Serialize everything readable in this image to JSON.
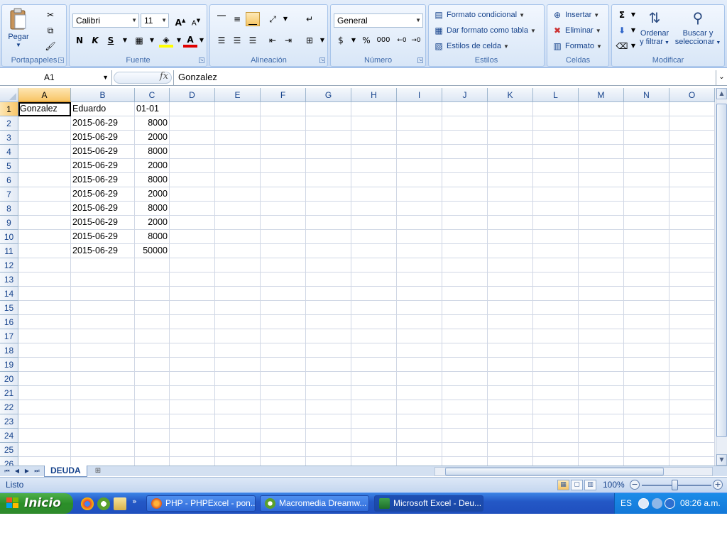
{
  "ribbon": {
    "clipboard": {
      "label": "Portapapeles",
      "paste": "Pegar"
    },
    "font": {
      "label": "Fuente",
      "name": "Calibri",
      "size": "11",
      "bold": "N",
      "italic": "K",
      "underline": "S"
    },
    "alignment": {
      "label": "Alineación"
    },
    "number": {
      "label": "Número",
      "format": "General",
      "percent": "%",
      "thousands": "000"
    },
    "styles": {
      "label": "Estilos",
      "conditional": "Formato condicional",
      "as_table": "Dar formato como tabla",
      "cell_styles": "Estilos de celda"
    },
    "cells": {
      "label": "Celdas",
      "insert": "Insertar",
      "delete": "Eliminar",
      "format": "Formato"
    },
    "editing": {
      "label": "Modificar",
      "sort_line1": "Ordenar",
      "sort_line2": "y filtrar",
      "find_line1": "Buscar y",
      "find_line2": "seleccionar"
    }
  },
  "formula_bar": {
    "name_box": "A1",
    "fx": "fx",
    "value": "Gonzalez"
  },
  "grid": {
    "columns": [
      "A",
      "B",
      "C",
      "D",
      "E",
      "F",
      "G",
      "H",
      "I",
      "J",
      "K",
      "L",
      "M",
      "N",
      "O"
    ],
    "rows": [
      "1",
      "2",
      "3",
      "4",
      "5",
      "6",
      "7",
      "8",
      "9",
      "10",
      "11",
      "12",
      "13",
      "14",
      "15",
      "16",
      "17",
      "18",
      "19",
      "20",
      "21",
      "22",
      "23",
      "24",
      "25",
      "26"
    ],
    "cells": {
      "r1": [
        "Gonzalez",
        "Eduardo",
        "01-01"
      ],
      "r2": [
        "",
        "2015-06-29",
        "8000"
      ],
      "r3": [
        "",
        "2015-06-29",
        "2000"
      ],
      "r4": [
        "",
        "2015-06-29",
        "8000"
      ],
      "r5": [
        "",
        "2015-06-29",
        "2000"
      ],
      "r6": [
        "",
        "2015-06-29",
        "8000"
      ],
      "r7": [
        "",
        "2015-06-29",
        "2000"
      ],
      "r8": [
        "",
        "2015-06-29",
        "8000"
      ],
      "r9": [
        "",
        "2015-06-29",
        "2000"
      ],
      "r10": [
        "",
        "2015-06-29",
        "8000"
      ],
      "r11": [
        "",
        "2015-06-29",
        "50000"
      ]
    }
  },
  "sheet_tabs": {
    "active": "DEUDA"
  },
  "status_bar": {
    "status": "Listo",
    "zoom": "100%"
  },
  "taskbar": {
    "start": "Inicio",
    "tasks": [
      "PHP - PHPExcel - pon...",
      "Macromedia Dreamw...",
      "Microsoft Excel - Deu..."
    ],
    "lang": "ES",
    "clock": "08:26 a.m."
  }
}
